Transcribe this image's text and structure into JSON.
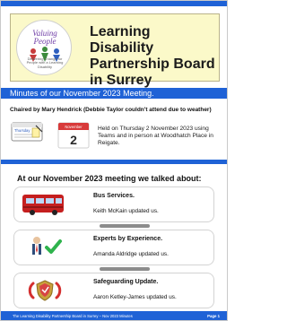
{
  "header": {
    "logo_text": "Valuing People",
    "logo_subtext": "Delivering Change for People with a Learning Disability",
    "title": "Learning Disability Partnership Board in Surrey"
  },
  "minutes": {
    "banner": "Minutes of our November 2023 Meeting."
  },
  "chair": {
    "line": "Chaired by Mary Hendrick (Debbie Taylor couldn't attend due to weather)"
  },
  "meeting": {
    "calendar_day": "Thursday",
    "badge_month": "November",
    "badge_day": "2",
    "held_text": "Held on Thursday 2 November 2023 using Teams and in person at Woodhatch Place in Reigate."
  },
  "talked_about": {
    "title": "At our November 2023 meeting we talked about:",
    "items": [
      {
        "icon": "bus-icon",
        "title": "Bus Services.",
        "subtitle": "Keith McKain updated us."
      },
      {
        "icon": "expert-icon",
        "title": "Experts by Experience.",
        "subtitle": "Amanda Aldridge updated us."
      },
      {
        "icon": "shield-alarm-icon",
        "title": "Safeguarding Update.",
        "subtitle": "Aaron Ketley-James updated us."
      }
    ]
  },
  "footer": {
    "left": "The Learning Disability Partnership Board in Surrey  –  Nov 2023 Minutes",
    "page": "Page 1"
  }
}
